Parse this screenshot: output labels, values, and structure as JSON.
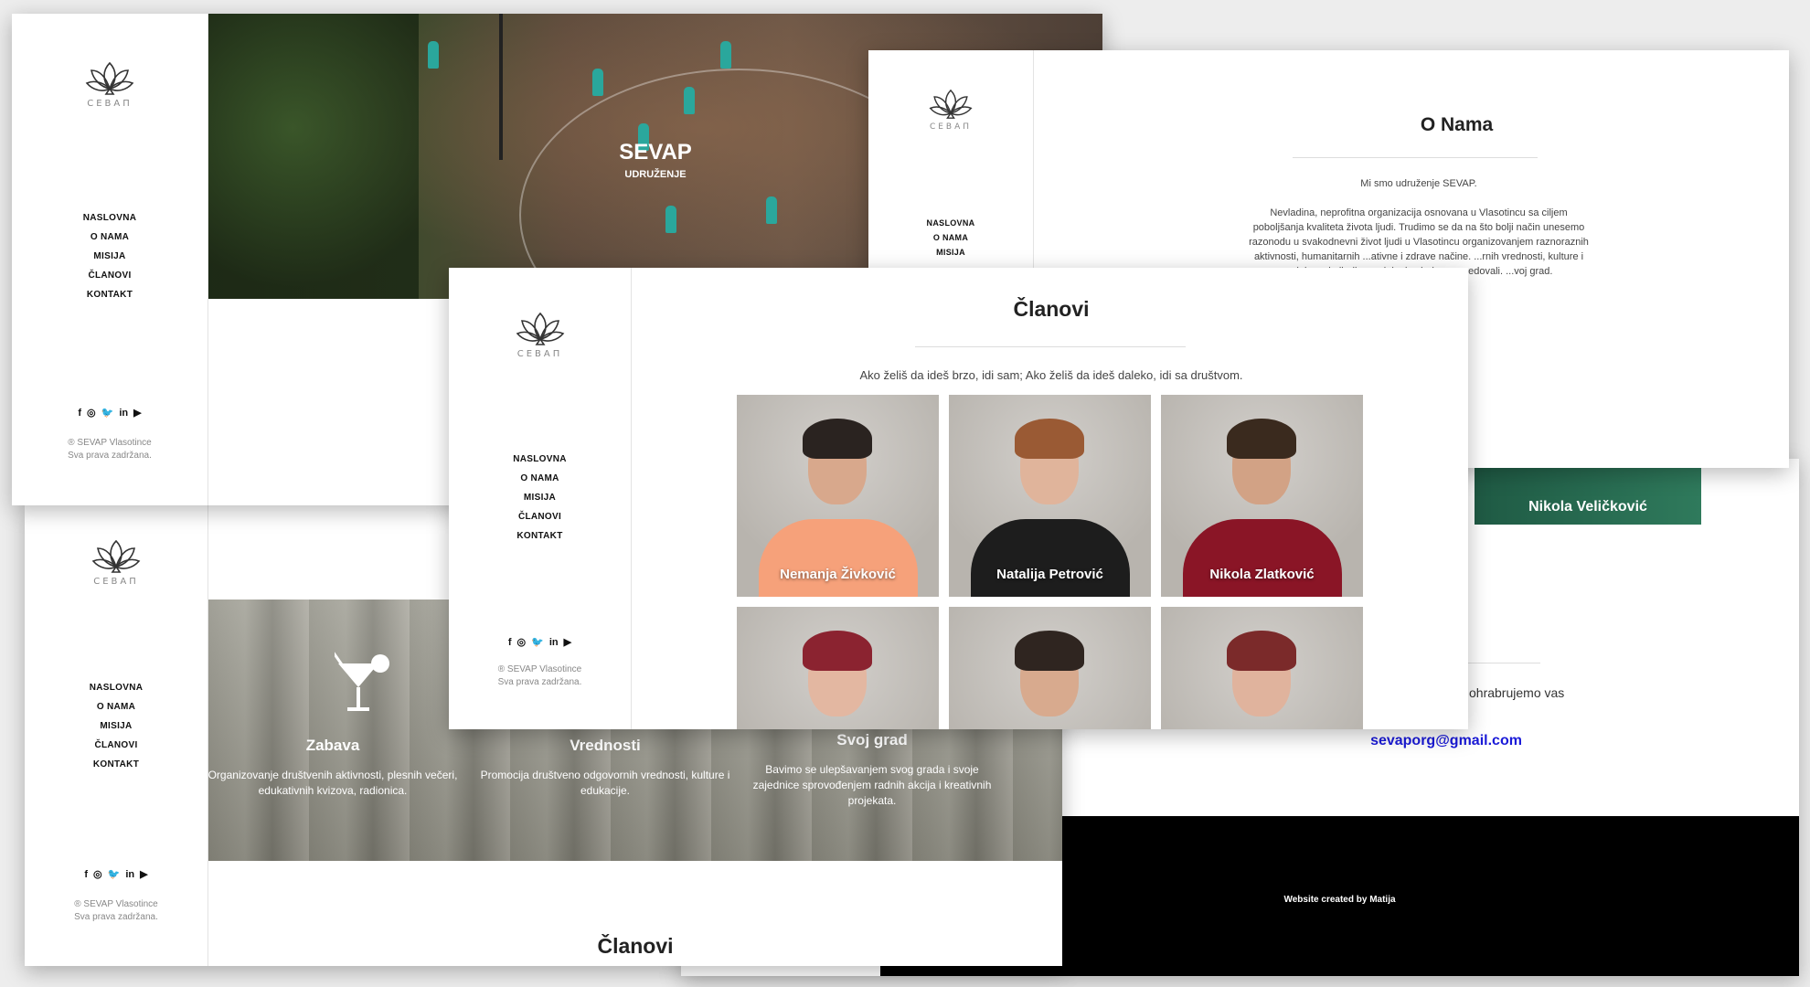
{
  "brand": {
    "logo_text": "CEBAП"
  },
  "nav": [
    "NASLOVNA",
    "O NAMA",
    "MISIJA",
    "ČLANOVI",
    "KONTAKT"
  ],
  "social_icons": [
    "facebook-icon",
    "instagram-icon",
    "twitter-icon",
    "linkedin-icon",
    "youtube-icon"
  ],
  "social_glyphs": [
    "f",
    "◎",
    "🐦",
    "in",
    "▶"
  ],
  "copyright": [
    "® SEVAP Vlasotince",
    "Sva prava zadržana."
  ],
  "hero": {
    "title": "SEVAP",
    "subtitle": "UDRUŽENJE"
  },
  "about": {
    "title": "O Nama",
    "intro": "Mi smo udruženje SEVAP.",
    "body": "Nevladina, neprofitna organizacija osnovana u Vlasotincu sa ciljem poboljšanja kvaliteta života ljudi. Trudimo se da na što bolji način unesemo razonodu u svakodnevni život ljudi u Vlasotincu organizovanjem raznoraznih aktivnosti, humanitarnih ...ativne i zdrave načine. ...rnih vrednosti, kulture i ...delovanja ljudi u svojoj ...i zajedno napredovali. ...voj grad."
  },
  "members": {
    "title": "Članovi",
    "quote": "Ako želiš da ideš brzo, idi sam; Ako želiš da ideš daleko, idi sa društvom.",
    "people": [
      {
        "name": "Nemanja Živković",
        "shirt": "#f6a17a",
        "hair": "#2a2320",
        "skin": "#d8a88c"
      },
      {
        "name": "Natalija Petrović",
        "shirt": "#1d1d1d",
        "hair": "#9a5a34",
        "skin": "#e0b49b"
      },
      {
        "name": "Nikola Zlatković",
        "shirt": "#8a1526",
        "hair": "#3a2a1e",
        "skin": "#d2a285"
      },
      {
        "name": "",
        "shirt": "#b8463e",
        "hair": "#8b2330",
        "skin": "#e3b7a1"
      },
      {
        "name": "",
        "shirt": "#c5202b",
        "hair": "#2f2520",
        "skin": "#d8aa8e"
      },
      {
        "name": "",
        "shirt": "#3a3a3a",
        "hair": "#7b2a2a",
        "skin": "#e0b39d"
      }
    ]
  },
  "features": {
    "items": [
      {
        "title": "Zabava",
        "text": "Organizovanje društvenih aktivnosti, plesnih večeri, edukativnih kvizova, radionica."
      },
      {
        "title": "Vrednosti",
        "text": "Promocija društveno odgovornih vrednosti, kulture i edukacije."
      },
      {
        "title": "Svoj grad",
        "text": "Bavimo se ulepšavanjem svog grada i svoje zajednice sprovođenjem radnih akcija i kreativnih projekata."
      }
    ],
    "members_heading": "Članovi"
  },
  "contact": {
    "member_strip": "Nikola Veličković",
    "text": "ohrabrujemo vas",
    "email": "sevaporg@gmail.com",
    "footer": "Website created by Matija"
  },
  "colors": {
    "email_link": "#1a1ad8",
    "footer_bg": "#000000",
    "page_bg": "#ededed"
  }
}
